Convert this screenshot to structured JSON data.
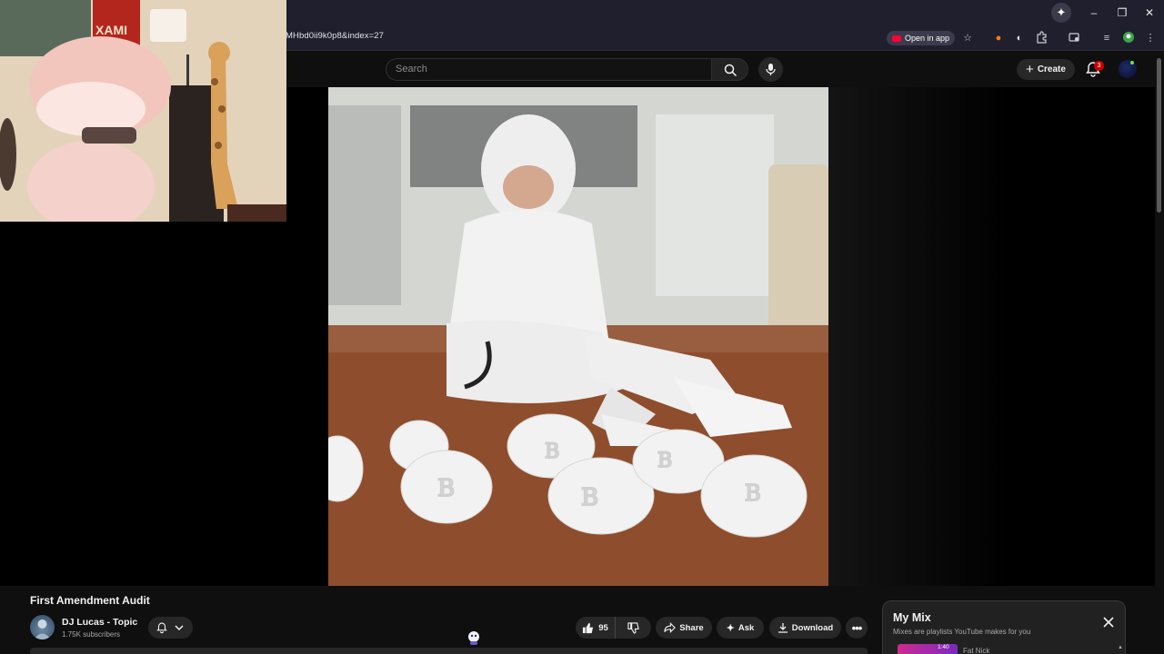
{
  "browser": {
    "url_visible": "MHbd0ii9k0p8&index=27",
    "open_in_app_label": "Open in app",
    "window_controls": [
      "minimize-icon",
      "restore-icon",
      "close-icon"
    ],
    "toolbar_icons": [
      "bookmark-star-icon",
      "extension-fox-icon",
      "extension-circle-icon",
      "extensions-puzzle-icon",
      "cast-icon",
      "media-controls-icon",
      "profile-icon",
      "menu-kebab-icon"
    ]
  },
  "youtube": {
    "search": {
      "placeholder": "Search"
    },
    "create_label": "Create",
    "notification_count": "3",
    "video": {
      "title": "First Amendment Audit",
      "channel_name": "DJ Lucas - Topic",
      "subscribers": "1.75K subscribers",
      "like_count": "95",
      "share_label": "Share",
      "ask_label": "Ask",
      "download_label": "Download"
    },
    "mix": {
      "title": "My Mix",
      "subtitle": "Mixes are playlists YouTube makes for you",
      "first_item_time": "1:40",
      "first_item_artist": "Fat Nick"
    }
  },
  "colors": {
    "page_bg": "#0f0f0f",
    "chrome_bg": "#1f1f2e",
    "pill_bg": "#272727",
    "youtube_red": "#ff0033",
    "notification_red": "#cc0000"
  }
}
